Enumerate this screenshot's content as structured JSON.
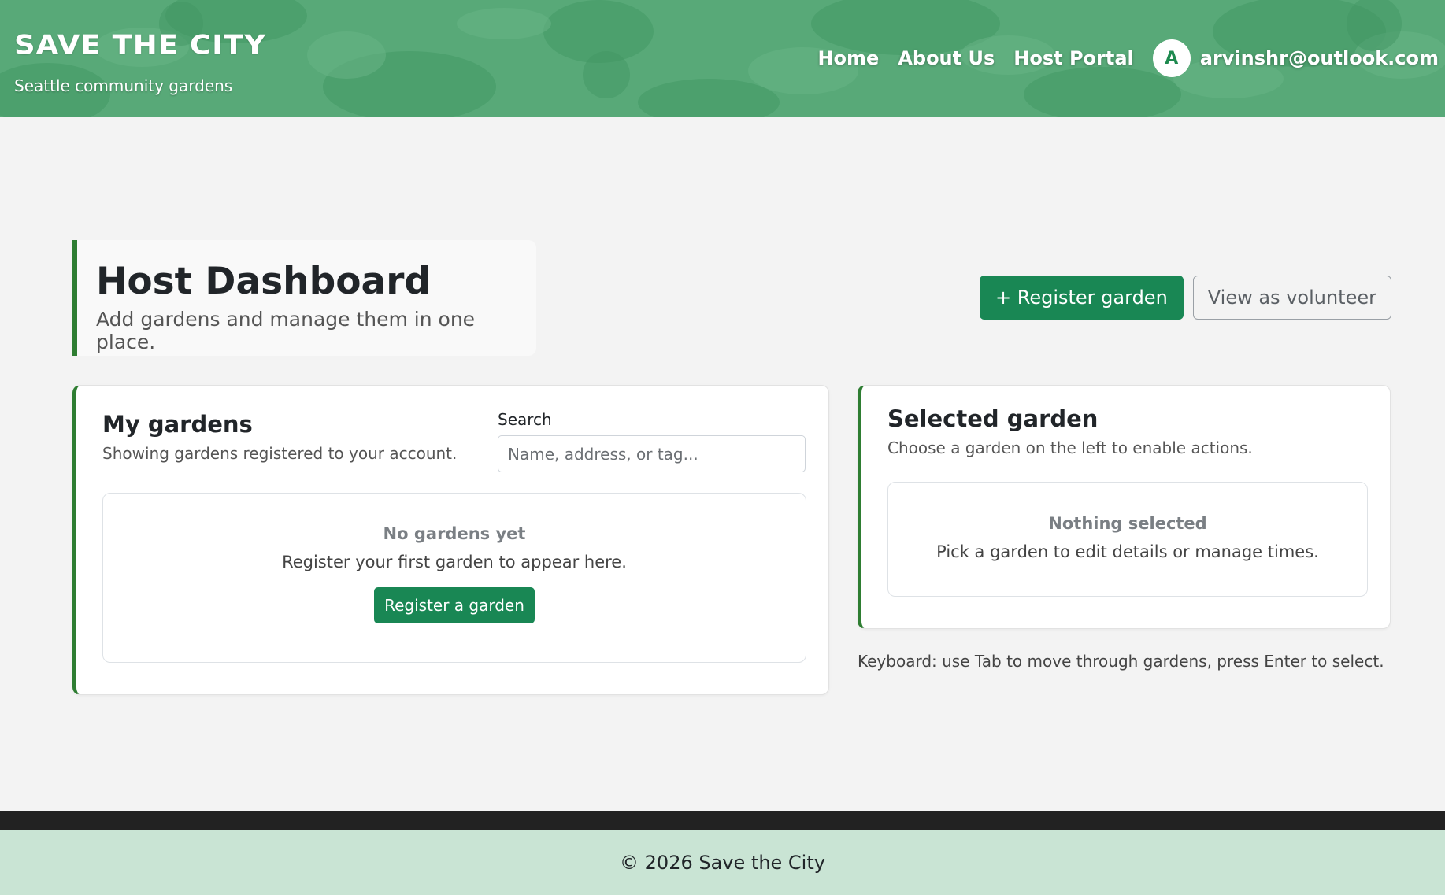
{
  "header": {
    "brand_title": "SAVE THE CITY",
    "brand_subtitle": "Seattle community gardens",
    "nav": {
      "home": "Home",
      "about": "About Us",
      "host_portal": "Host Portal"
    },
    "user": {
      "avatar_initial": "A",
      "email": "arvinshr@outlook.com"
    }
  },
  "page": {
    "title": "Host Dashboard",
    "subtitle": "Add gardens and manage them in one place.",
    "actions": {
      "register_label": "+ Register garden",
      "view_volunteer_label": "View as volunteer"
    }
  },
  "my_gardens": {
    "title": "My gardens",
    "subtitle": "Showing gardens registered to your account.",
    "search_label": "Search",
    "search_placeholder": "Name, address, or tag...",
    "search_value": "",
    "empty_title": "No gardens yet",
    "empty_text": "Register your first garden to appear here.",
    "empty_button": "Register a garden"
  },
  "selected_garden": {
    "title": "Selected garden",
    "subtitle": "Choose a garden on the left to enable actions.",
    "empty_title": "Nothing selected",
    "empty_text": "Pick a garden to edit details or manage times."
  },
  "keyboard_hint": "Keyboard: use Tab to move through gardens, press Enter to select.",
  "footer": {
    "copyright": "© 2026 Save the City"
  },
  "colors": {
    "accent_green": "#198754",
    "card_border_green": "#2e7d32",
    "header_green": "#5aa77a",
    "footer_bg": "#c9e4d4",
    "footer_bar": "#222222"
  }
}
